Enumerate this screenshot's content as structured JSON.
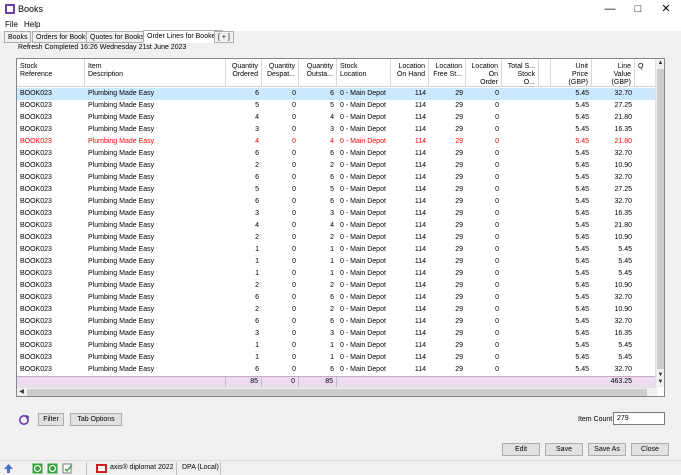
{
  "window": {
    "title": "Books"
  },
  "menu": [
    "File",
    "Help"
  ],
  "tabs": [
    "Books",
    "Orders for Books",
    "Quotes for Books",
    "Order Lines for Bookes",
    "[ + ]"
  ],
  "refresh_status": "Refresh Completed 16:26 Wednesday 21st June 2023",
  "columns": [
    {
      "l1": "Stock",
      "l2": "Reference"
    },
    {
      "l1": "Item",
      "l2": "Description"
    },
    {
      "l1": "Quantity",
      "l2": "Ordered"
    },
    {
      "l1": "Quantity",
      "l2": "Despat..."
    },
    {
      "l1": "Quantity",
      "l2": "Outsta..."
    },
    {
      "l1": "Stock",
      "l2": "Location"
    },
    {
      "l1": "Location",
      "l2": "On Hand"
    },
    {
      "l1": "Location",
      "l2": "Free St..."
    },
    {
      "l1": "Location",
      "l2": "On Order"
    },
    {
      "l1": "Total S...",
      "l2": "Stock O..."
    },
    {
      "l1": "",
      "l2": ""
    },
    {
      "l1": "Unit",
      "l2": "Price",
      "l3": "(GBP)"
    },
    {
      "l1": "Line",
      "l2": "Value",
      "l3": "(GBP)"
    },
    {
      "l1": "Q",
      "l2": ""
    }
  ],
  "rows": [
    [
      "BOOK023",
      "Plumbing Made Easy",
      "6",
      "0",
      "6",
      "0 - Main Depot",
      "114",
      "29",
      "0",
      "",
      "",
      "5.45",
      "32.70"
    ],
    [
      "BOOK023",
      "Plumbing Made Easy",
      "5",
      "0",
      "5",
      "0 - Main Depot",
      "114",
      "29",
      "0",
      "",
      "",
      "5.45",
      "27.25"
    ],
    [
      "BOOK023",
      "Plumbing Made Easy",
      "4",
      "0",
      "4",
      "0 - Main Depot",
      "114",
      "29",
      "0",
      "",
      "",
      "5.45",
      "21.80"
    ],
    [
      "BOOK023",
      "Plumbing Made Easy",
      "3",
      "0",
      "3",
      "0 - Main Depot",
      "114",
      "29",
      "0",
      "",
      "",
      "5.45",
      "16.35"
    ],
    [
      "BOOK023",
      "Plumbing Made Easy",
      "4",
      "0",
      "4",
      "0 - Main Depot",
      "114",
      "29",
      "0",
      "",
      "",
      "5.45",
      "21.80"
    ],
    [
      "BOOK023",
      "Plumbing Made Easy",
      "6",
      "0",
      "6",
      "0 - Main Depot",
      "114",
      "29",
      "0",
      "",
      "",
      "5.45",
      "32.70"
    ],
    [
      "BOOK023",
      "Plumbing Made Easy",
      "2",
      "0",
      "2",
      "0 - Main Depot",
      "114",
      "29",
      "0",
      "",
      "",
      "5.45",
      "10.90"
    ],
    [
      "BOOK023",
      "Plumbing Made Easy",
      "6",
      "0",
      "6",
      "0 - Main Depot",
      "114",
      "29",
      "0",
      "",
      "",
      "5.45",
      "32.70"
    ],
    [
      "BOOK023",
      "Plumbing Made Easy",
      "5",
      "0",
      "5",
      "0 - Main Depot",
      "114",
      "29",
      "0",
      "",
      "",
      "5.45",
      "27.25"
    ],
    [
      "BOOK023",
      "Plumbing Made Easy",
      "6",
      "0",
      "6",
      "0 - Main Depot",
      "114",
      "29",
      "0",
      "",
      "",
      "5.45",
      "32.70"
    ],
    [
      "BOOK023",
      "Plumbing Made Easy",
      "3",
      "0",
      "3",
      "0 - Main Depot",
      "114",
      "29",
      "0",
      "",
      "",
      "5.45",
      "16.35"
    ],
    [
      "BOOK023",
      "Plumbing Made Easy",
      "4",
      "0",
      "4",
      "0 - Main Depot",
      "114",
      "29",
      "0",
      "",
      "",
      "5.45",
      "21.80"
    ],
    [
      "BOOK023",
      "Plumbing Made Easy",
      "2",
      "0",
      "2",
      "0 - Main Depot",
      "114",
      "29",
      "0",
      "",
      "",
      "5.45",
      "10.90"
    ],
    [
      "BOOK023",
      "Plumbing Made Easy",
      "1",
      "0",
      "1",
      "0 - Main Depot",
      "114",
      "29",
      "0",
      "",
      "",
      "5.45",
      "5.45"
    ],
    [
      "BOOK023",
      "Plumbing Made Easy",
      "1",
      "0",
      "1",
      "0 - Main Depot",
      "114",
      "29",
      "0",
      "",
      "",
      "5.45",
      "5.45"
    ],
    [
      "BOOK023",
      "Plumbing Made Easy",
      "1",
      "0",
      "1",
      "0 - Main Depot",
      "114",
      "29",
      "0",
      "",
      "",
      "5.45",
      "5.45"
    ],
    [
      "BOOK023",
      "Plumbing Made Easy",
      "2",
      "0",
      "2",
      "0 - Main Depot",
      "114",
      "29",
      "0",
      "",
      "",
      "5.45",
      "10.90"
    ],
    [
      "BOOK023",
      "Plumbing Made Easy",
      "6",
      "0",
      "6",
      "0 - Main Depot",
      "114",
      "29",
      "0",
      "",
      "",
      "5.45",
      "32.70"
    ],
    [
      "BOOK023",
      "Plumbing Made Easy",
      "2",
      "0",
      "2",
      "0 - Main Depot",
      "114",
      "29",
      "0",
      "",
      "",
      "5.45",
      "10.90"
    ],
    [
      "BOOK023",
      "Plumbing Made Easy",
      "6",
      "0",
      "6",
      "0 - Main Depot",
      "114",
      "29",
      "0",
      "",
      "",
      "5.45",
      "32.70"
    ],
    [
      "BOOK023",
      "Plumbing Made Easy",
      "3",
      "0",
      "3",
      "0 - Main Depot",
      "114",
      "29",
      "0",
      "",
      "",
      "5.45",
      "16.35"
    ],
    [
      "BOOK023",
      "Plumbing Made Easy",
      "1",
      "0",
      "1",
      "0 - Main Depot",
      "114",
      "29",
      "0",
      "",
      "",
      "5.45",
      "5.45"
    ],
    [
      "BOOK023",
      "Plumbing Made Easy",
      "1",
      "0",
      "1",
      "0 - Main Depot",
      "114",
      "29",
      "0",
      "",
      "",
      "5.45",
      "5.45"
    ],
    [
      "BOOK023",
      "Plumbing Made Easy",
      "6",
      "0",
      "6",
      "0 - Main Depot",
      "114",
      "29",
      "0",
      "",
      "",
      "5.45",
      "32.70"
    ]
  ],
  "selected_row": 0,
  "highlight_row": 4,
  "totals": {
    "ordered": "85",
    "despatched": "0",
    "outstanding": "85",
    "line_value": "463.25"
  },
  "buttons": {
    "filter": "Filter",
    "tab_options": "Tab Options",
    "edit": "Edit",
    "save": "Save",
    "save_as": "Save As",
    "close": "Close"
  },
  "item_count": {
    "label": "Item Count",
    "value": "279"
  },
  "status": {
    "app": "axis® diplomat 2022",
    "dpa": "DPA (Local)"
  },
  "colors": {
    "selected": "#cce8ff",
    "highlight_text": "#ff0000",
    "totals_bg": "#eedcee"
  }
}
